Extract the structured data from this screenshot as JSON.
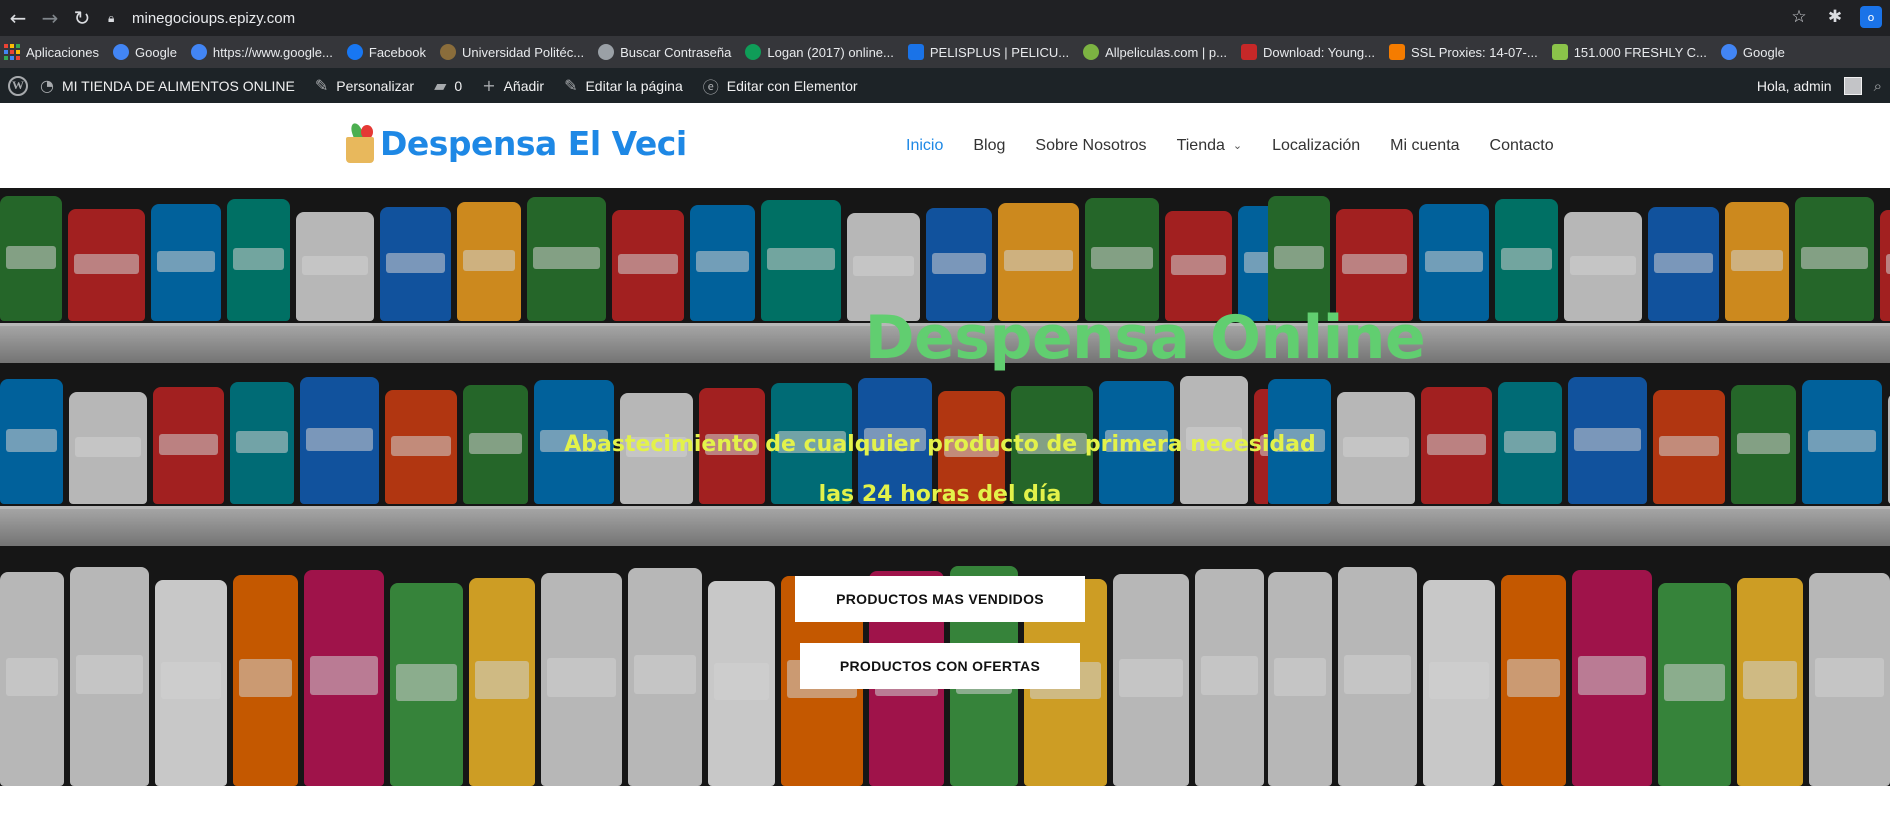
{
  "browser": {
    "url": "minegocioups.epizy.com",
    "bookmarks": [
      {
        "label": "Aplicaciones",
        "icon": "apps-grid-icon"
      },
      {
        "label": "Google",
        "icon": "google-icon",
        "color": "#4285f4"
      },
      {
        "label": "https://www.google...",
        "icon": "google-icon",
        "color": "#4285f4"
      },
      {
        "label": "Facebook",
        "icon": "facebook-icon",
        "color": "#1877f2"
      },
      {
        "label": "Universidad Politéc...",
        "icon": "university-icon",
        "color": "#8a6d3b"
      },
      {
        "label": "Buscar Contraseña",
        "icon": "globe-icon",
        "color": "#9aa0a6"
      },
      {
        "label": "Logan (2017) online...",
        "icon": "c-logo-icon",
        "color": "#0f9d58"
      },
      {
        "label": "PELISPLUS | PELICU...",
        "icon": "pelisplus-icon",
        "color": "#1a73e8"
      },
      {
        "label": "Allpeliculas.com | p...",
        "icon": "allpeliculas-icon",
        "color": "#7cb342"
      },
      {
        "label": "Download: Young...",
        "icon": "download-site-icon",
        "color": "#c62828"
      },
      {
        "label": "SSL Proxies: 14-07-...",
        "icon": "blogger-icon",
        "color": "#f57c00"
      },
      {
        "label": "151.000 FRESHLY C...",
        "icon": "freshly-icon",
        "color": "#8bc34a"
      },
      {
        "label": "Google",
        "icon": "google-icon",
        "color": "#4285f4"
      }
    ]
  },
  "wp_admin": {
    "site_name": "MI TIENDA DE ALIMENTOS ONLINE",
    "customize": "Personalizar",
    "comments_count": "0",
    "add_new": "Añadir",
    "edit_page": "Editar la página",
    "edit_elementor": "Editar con Elementor",
    "greeting": "Hola, admin"
  },
  "site": {
    "brand": "Despensa El Veci",
    "menu": [
      {
        "label": "Inicio",
        "active": true
      },
      {
        "label": "Blog"
      },
      {
        "label": "Sobre Nosotros"
      },
      {
        "label": "Tienda",
        "has_submenu": true
      },
      {
        "label": "Localización"
      },
      {
        "label": "Mi cuenta"
      },
      {
        "label": "Contacto"
      }
    ]
  },
  "hero": {
    "title": "Despensa Online",
    "subtitle": "Abastecimiento de cualquier producto de primera necesidad las 24 horas del día",
    "button_1": "PRODUCTOS MAS VENDIDOS",
    "button_2": "PRODUCTOS CON OFERTAS",
    "title_color": "#61ce70",
    "subtitle_color": "#e3f24a"
  }
}
